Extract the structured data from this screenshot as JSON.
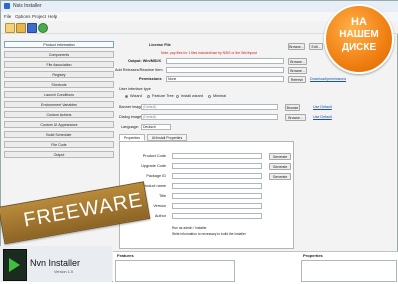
{
  "window": {
    "title": "Nsis Installer"
  },
  "menu": [
    "File",
    "Options",
    "Project",
    "Help"
  ],
  "sidebar": {
    "items": [
      {
        "label": "Product information"
      },
      {
        "label": "Components"
      },
      {
        "label": "File Association"
      },
      {
        "label": "Registry"
      },
      {
        "label": "Shortcuts"
      },
      {
        "label": "Launch Conditions"
      },
      {
        "label": "Environment Variables"
      },
      {
        "label": "Custom Actions"
      },
      {
        "label": "Custom UI Appearance"
      },
      {
        "label": "Build Scheduler"
      },
      {
        "label": "File Code"
      },
      {
        "label": "Output"
      }
    ]
  },
  "form": {
    "license_file": "License File",
    "license_warning": "Note: pay files for 1 files included/use by NSIS or the Wix/Inpost",
    "license_browse": "Browse...",
    "license_edit": "Edit...",
    "output_label": "Output: Win/MSI/X",
    "output_browse": "Browse...",
    "readme_label": "Add Releases/Readme Item",
    "readme_browse": "Browse...",
    "permissions_label": "Permissions",
    "permissions_value": "None",
    "refresh": "Refresh",
    "download_link": "Download/permissions",
    "ui_type_label": "User interface type",
    "radio_1": "Wizard",
    "radio_2": "Feature Tree",
    "radio_3": "Install wizard",
    "radio_4": "Minimal",
    "banner_label": "Banner image",
    "banner_value": "(Default)",
    "banner_browse": "Browse",
    "banner_link": "Use Default",
    "dialog_label": "Dialog image",
    "dialog_value": "(Default)",
    "dialog_browse": "Browse...",
    "dialog_link": "Use Default",
    "language_label": "Language:",
    "language_value": "Deutsch"
  },
  "tabs": [
    "Properties",
    "UI/Install Properties"
  ],
  "properties": {
    "fields": [
      "Product Code",
      "Upgrade Code",
      "Package ID",
      "Product name",
      "Title",
      "Version",
      "Author"
    ],
    "generate_1": "Generate",
    "generate_2": "Generate",
    "generate_3": "Generate",
    "note_1": "Run as admin / Installer",
    "note_2": "Write information to necessary to build the installer"
  },
  "bottom": {
    "features_label": "Features",
    "properties_label": "Properties"
  },
  "branding": {
    "freeware": "FREEWARE",
    "app_name": "Nvn Installer",
    "version": "Version 1.5"
  },
  "badge": {
    "line1": "НА",
    "line2": "НАШЕМ",
    "line3": "ДИСКЕ"
  }
}
